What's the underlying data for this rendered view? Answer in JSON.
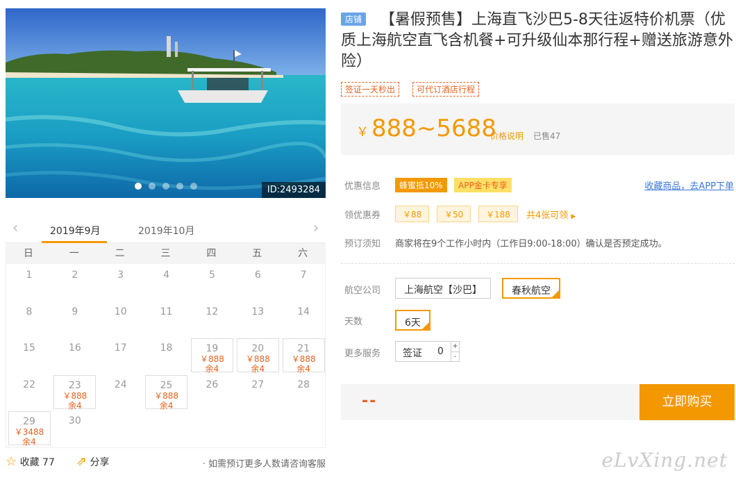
{
  "hero": {
    "image_id": "ID:2493284"
  },
  "calendar": {
    "months": [
      "2019年9月",
      "2019年10月"
    ],
    "weekdays": [
      "日",
      "一",
      "二",
      "三",
      "四",
      "五",
      "六"
    ],
    "days": [
      {
        "d": "1"
      },
      {
        "d": "2"
      },
      {
        "d": "3"
      },
      {
        "d": "4"
      },
      {
        "d": "5"
      },
      {
        "d": "6"
      },
      {
        "d": "7"
      },
      {
        "d": "8"
      },
      {
        "d": "9"
      },
      {
        "d": "10"
      },
      {
        "d": "11"
      },
      {
        "d": "12"
      },
      {
        "d": "13"
      },
      {
        "d": "14"
      },
      {
        "d": "15"
      },
      {
        "d": "16"
      },
      {
        "d": "17"
      },
      {
        "d": "18"
      },
      {
        "d": "19",
        "p": "￥888",
        "s": "余4"
      },
      {
        "d": "20",
        "p": "￥888",
        "s": "余4"
      },
      {
        "d": "21",
        "p": "￥888",
        "s": "余4"
      },
      {
        "d": "22"
      },
      {
        "d": "23",
        "p": "￥888",
        "s": "余4"
      },
      {
        "d": "24"
      },
      {
        "d": "25",
        "p": "￥888",
        "s": "余4"
      },
      {
        "d": "26"
      },
      {
        "d": "27"
      },
      {
        "d": "28"
      },
      {
        "d": "29",
        "p": "￥3488",
        "s": "余4"
      },
      {
        "d": "30"
      }
    ]
  },
  "footer": {
    "favorite": "收藏",
    "favorite_count": "77",
    "share": "分享",
    "note": "· 如需预订更多人数请咨询客服"
  },
  "product": {
    "store_tag": "店铺",
    "title": "【暑假预售】上海直飞沙巴5-8天往返特价机票（优质上海航空直飞含机餐+可升级仙本那行程+赠送旅游意外险）",
    "tags": [
      "签证一天秒出",
      "可代订酒店行程"
    ],
    "currency": "￥",
    "price": "888~5688",
    "price_note": "价格说明",
    "sold": "已售47"
  },
  "info": {
    "discount_label": "优惠信息",
    "deal_badge": "蜂蜜抵10%",
    "app_badge": "APP金卡专享",
    "fav_link": "收藏商品，去APP下单",
    "coupon_label": "领优惠券",
    "coupons": [
      "￥88",
      "￥50",
      "￥188"
    ],
    "coupon_more": "共4张可领",
    "notice_label": "预订须知",
    "notice": "商家将在9个工作小时内（工作日9:00-18:00）确认是否预定成功。"
  },
  "options": {
    "airline_label": "航空公司",
    "airlines": [
      "上海航空【沙巴】",
      "春秋航空"
    ],
    "days_label": "天数",
    "days_value": "6天",
    "more_label": "更多服务",
    "service_name": "签证",
    "service_qty": "0",
    "plus": "+",
    "minus": "-"
  },
  "buy": {
    "total": "--",
    "button": "立即购买"
  },
  "watermark": "eLvXing.net",
  "colors": {
    "accent": "#f39800",
    "price": "#e8611d",
    "link": "#3b78d8"
  }
}
